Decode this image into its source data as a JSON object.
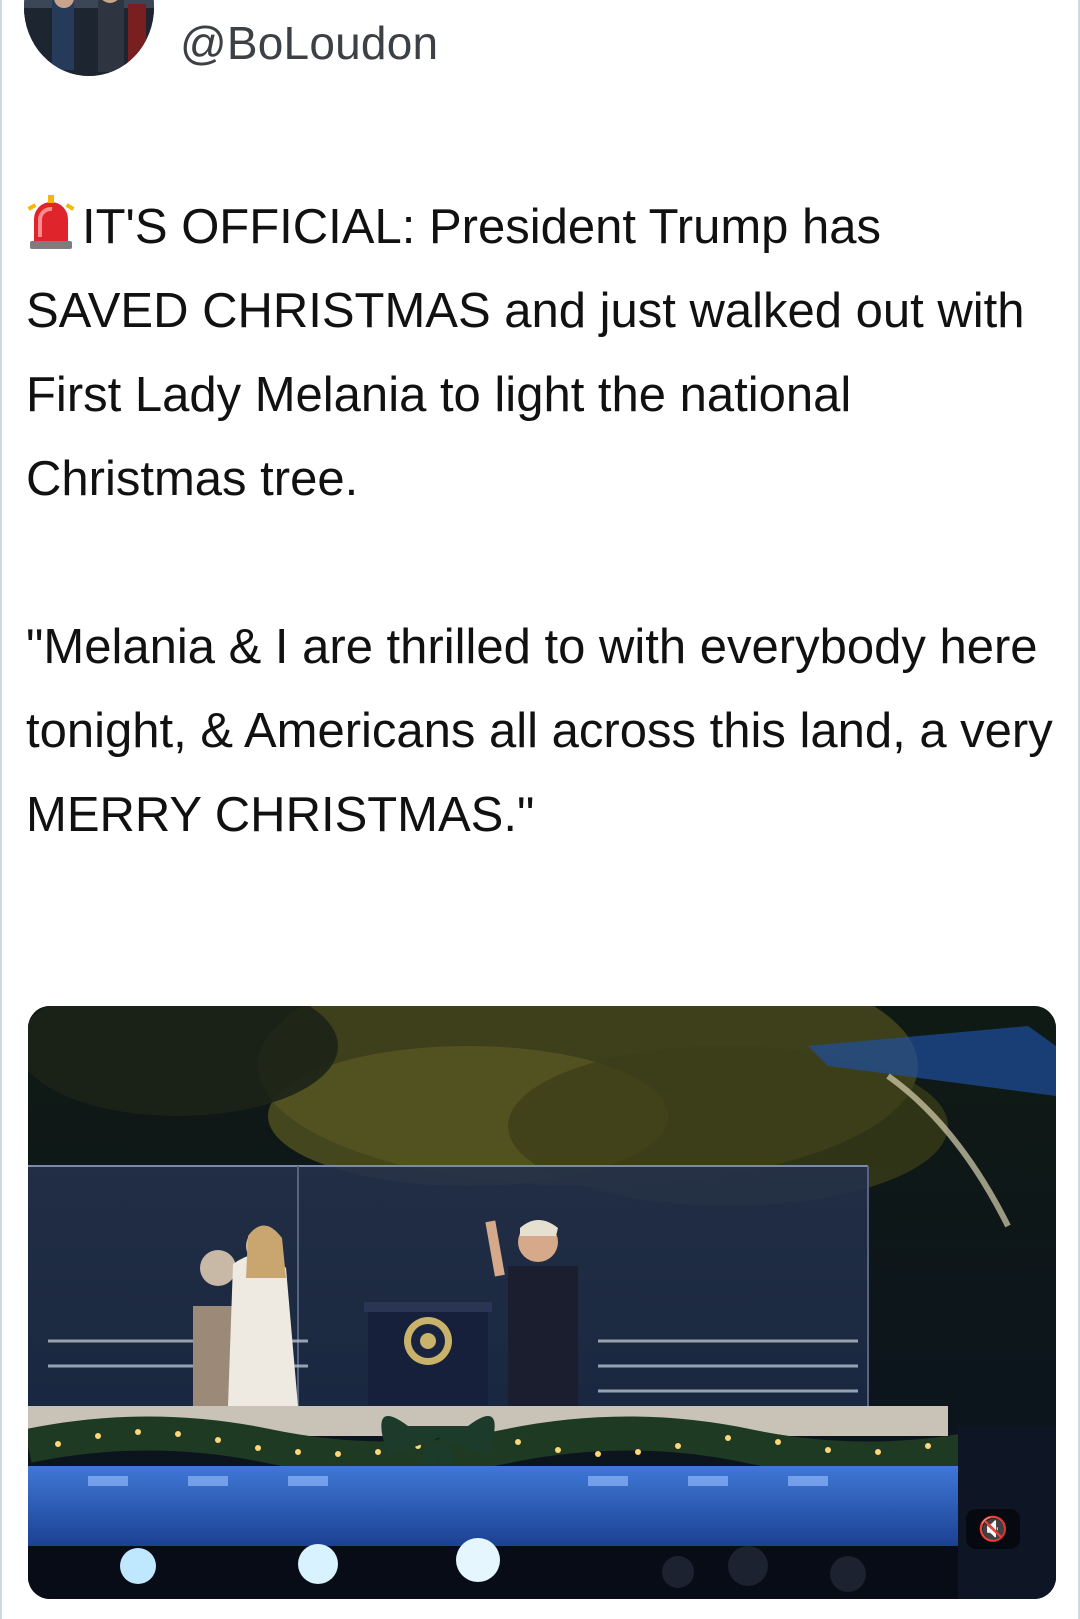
{
  "tweet": {
    "handle": "@BoLoudon",
    "paragraph_1": "IT'S OFFICIAL: President Trump has SAVED CHRISTMAS and just walked out with First Lady Melania to light the national Christmas tree.",
    "paragraph_2": "\"Melania & I are thrilled to with everybody here tonight, & Americans all across this land, a very MERRY CHRISTMAS.\"",
    "leading_icon": "police-siren-icon"
  },
  "media": {
    "type": "video",
    "mute_icon": "speaker-muted-icon",
    "mute_label": "🔇"
  }
}
